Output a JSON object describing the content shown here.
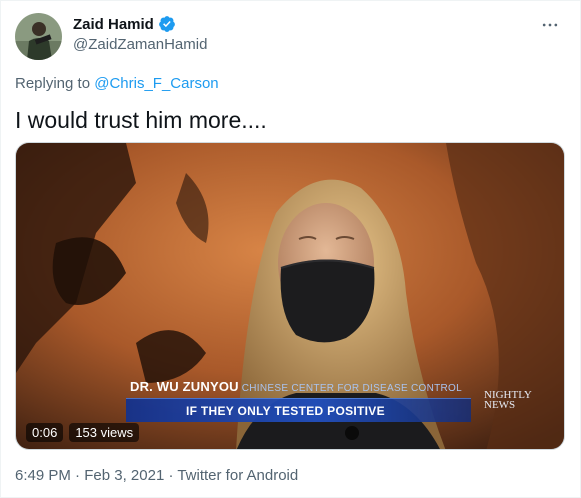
{
  "author": {
    "display_name": "Zaid Hamid",
    "handle": "@ZaidZamanHamid",
    "verified": true
  },
  "reply_context": {
    "prefix": "Replying to ",
    "mention": "@Chris_F_Carson"
  },
  "tweet": {
    "text": "I would trust him more...."
  },
  "video": {
    "lower_third_name": "DR. WU ZUNYOU",
    "lower_third_org": "CHINESE CENTER FOR DISEASE CONTROL",
    "lower_third_quote": "IF THEY ONLY TESTED POSITIVE",
    "network_logo_line1": "NIGHTLY",
    "network_logo_line2": "NEWS",
    "elapsed": "0:06",
    "views": "153 views"
  },
  "meta": {
    "time": "6:49 PM",
    "separator": " · ",
    "date": "Feb 3, 2021",
    "source": "Twitter for Android"
  },
  "icons": {
    "verified": "verified-badge-icon",
    "more": "more-options-icon"
  },
  "colors": {
    "accent": "#1d9bf0",
    "secondary_text": "#536471",
    "lower_third_bar": "#2350be"
  }
}
